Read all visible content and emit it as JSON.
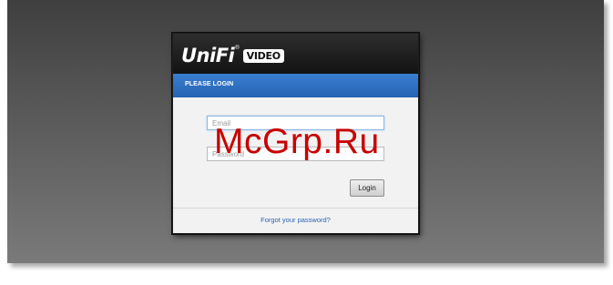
{
  "logo": {
    "brand": "UniFi",
    "registered_mark": "®",
    "product": "VIDEO"
  },
  "login_panel": {
    "title": "PLEASE LOGIN",
    "email_placeholder": "Email",
    "password_placeholder": "Password",
    "login_button": "Login",
    "forgot_link": "Forgot your password?"
  },
  "watermark": {
    "text": "McGrp.Ru",
    "color": "#c80000"
  },
  "colors": {
    "header_blue": "#2f70c2",
    "link_blue": "#2a62b8",
    "header_dark": "#1a1a1a"
  }
}
